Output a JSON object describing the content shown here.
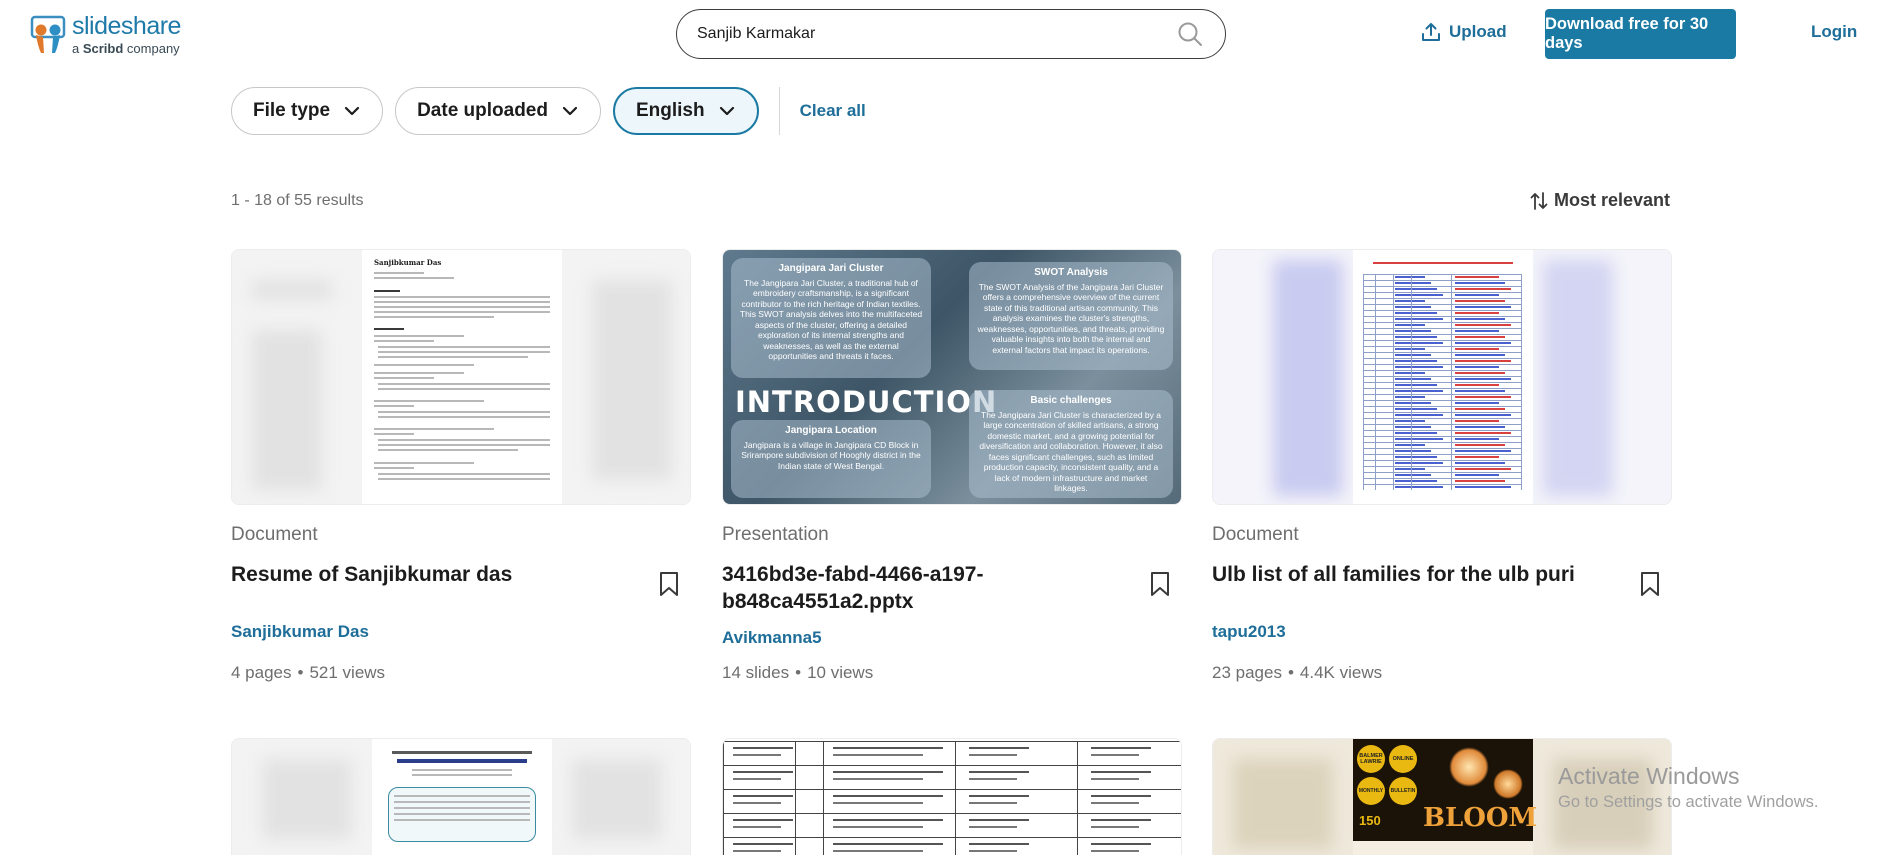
{
  "header": {
    "logo_name": "slideshare",
    "logo_sub_prefix": "a ",
    "logo_sub_brand": "Scribd",
    "logo_sub_suffix": " company",
    "search_value": "Sanjib Karmakar",
    "upload_label": "Upload",
    "download_label": "Download free for 30 days",
    "login_label": "Login"
  },
  "filters": {
    "file_type": "File type",
    "date_uploaded": "Date uploaded",
    "language": "English",
    "clear_all": "Clear all"
  },
  "results": {
    "count": "1 - 18 of 55 results",
    "sort": "Most relevant"
  },
  "cards": [
    {
      "type": "Document",
      "title": "Resume of Sanjibkumar das",
      "author": "Sanjibkumar Das",
      "count": "4 pages",
      "views": "521 views",
      "thumb_heading": "Sanjibkumar Das"
    },
    {
      "type": "Presentation",
      "title": "3416bd3e-fabd-4466-a197-b848ca4551a2.pptx",
      "author": "Avikmanna5",
      "count": "14 slides",
      "views": "10 views",
      "slide": {
        "box1_title": "Jangipara Jari Cluster",
        "box1_text": "The Jangipara Jari Cluster, a traditional hub of embroidery craftsmanship, is a significant contributor to the rich heritage of Indian textiles. This SWOT analysis delves into the multifaceted aspects of the cluster, offering a detailed exploration of its internal strengths and weaknesses, as well as the external opportunities and threats it faces.",
        "box2_title": "SWOT Analysis",
        "box2_text": "The SWOT Analysis of the Jangipara Jari Cluster offers a comprehensive overview of the current state of this traditional artisan community. This analysis examines the cluster's strengths, weaknesses, opportunities, and threats, providing valuable insights into both the internal and external factors that impact its operations.",
        "intro": "INTRODUCTION",
        "box3_title": "Jangipara Location",
        "box3_text": "Jangipara is a village in Jangipara CD Block in Srirampore subdivision of Hooghly district in the Indian state of West Bengal.",
        "box4_title": "Basic challenges",
        "box4_text": "The Jangipara Jari Cluster is characterized by a large concentration of skilled artisans, a strong domestic market, and a growing potential for diversification and collaboration. However, it also faces significant challenges, such as limited production capacity, inconsistent quality, and a lack of modern infrastructure and market linkages."
      }
    },
    {
      "type": "Document",
      "title": "Ulb list of all families for the ulb puri",
      "author": "tapu2013",
      "count": "23 pages",
      "views": "4.4K views"
    }
  ],
  "row2": {
    "card3_badge1": "BALMER LAWRIE",
    "card3_badge2": "ONLINE",
    "card3_badge3": "MONTHLY",
    "card3_badge4": "BULLETIN",
    "card3_num": "150",
    "card3_title": "BLOOM"
  },
  "watermark": {
    "title": "Activate Windows",
    "subtitle": "Go to Settings to activate Windows."
  },
  "colors": {
    "brand": "#1b7aa3",
    "link": "#1e6e99",
    "muted": "#6e6e6e"
  }
}
